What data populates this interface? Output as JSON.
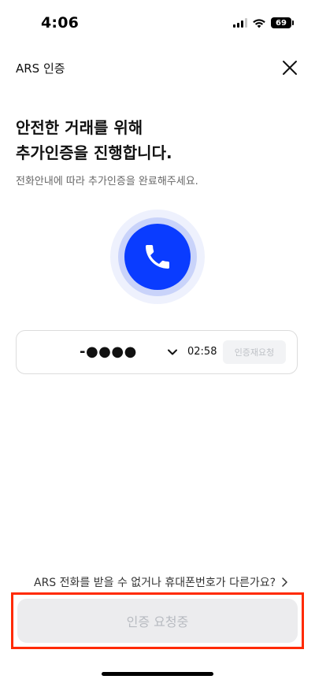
{
  "status_bar": {
    "time": "4:06",
    "battery": "69"
  },
  "header": {
    "title": "ARS 인증"
  },
  "headline": {
    "line1": "안전한 거래를 위해",
    "line2": "추가인증을 진행합니다."
  },
  "subtext": "전화안내에 따라 추가인증을 완료해주세요.",
  "number_card": {
    "phone_number": "-●●●●",
    "timer": "02:58",
    "resend_label": "인증재요청"
  },
  "help_link": {
    "label": "ARS 전화를 받을 수 없거나 휴대폰번호가 다른가요?"
  },
  "cta": {
    "label": "인증 요청중"
  },
  "colors": {
    "accent": "#0a3cff",
    "highlight": "#ff2a00"
  }
}
